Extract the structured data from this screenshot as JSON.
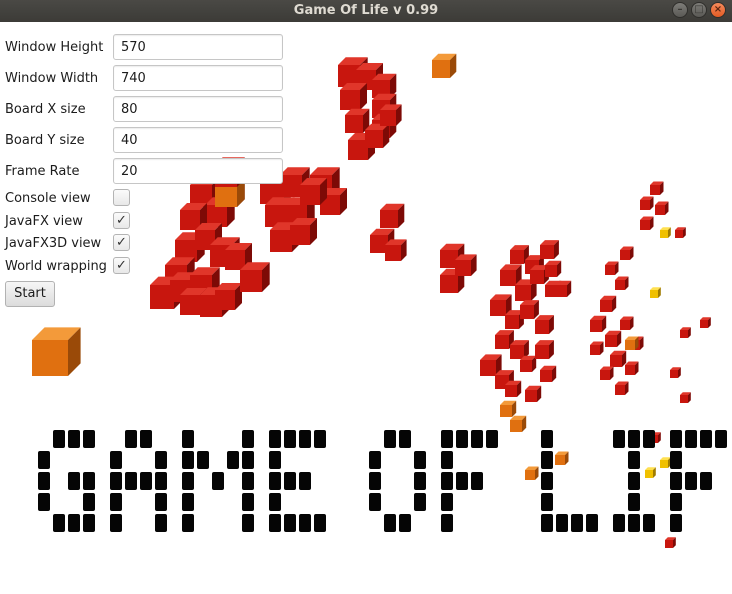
{
  "window": {
    "title": "Game Of Life  v 0.99",
    "controls": {
      "minimize": "–",
      "maximize": "□",
      "close": "×"
    }
  },
  "form": {
    "fields": [
      {
        "label": "Window Height",
        "value": "570"
      },
      {
        "label": "Window Width",
        "value": "740"
      },
      {
        "label": "Board X size",
        "value": "80"
      },
      {
        "label": "Board Y size",
        "value": "40"
      },
      {
        "label": "Frame Rate",
        "value": "20"
      }
    ],
    "checkboxes": [
      {
        "label": "Console view",
        "checked": false
      },
      {
        "label": "JavaFX view",
        "checked": true
      },
      {
        "label": "JavaFX3D view",
        "checked": true
      },
      {
        "label": "World wrapping",
        "checked": true
      }
    ],
    "start_label": "Start",
    "check_glyph": "✓"
  },
  "scene": {
    "colors": {
      "cube": "#c8160e",
      "cube_dark": "#7d0a06",
      "cube_orange": "#e07010",
      "cube_yellow": "#f0c000",
      "letter": "#050505"
    }
  }
}
